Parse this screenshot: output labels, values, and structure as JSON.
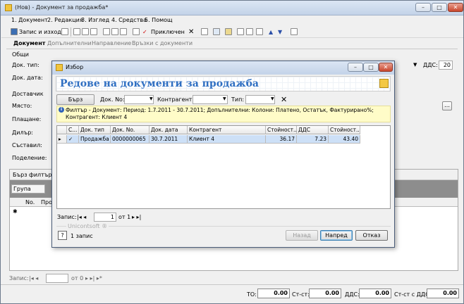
{
  "window": {
    "title": "(Нов) - Документ за продажба*"
  },
  "menu": [
    "1. Документ",
    "2. Редакция",
    "3. Изглед",
    "4. Средства",
    "5. Помощ"
  ],
  "toolbar": {
    "save_exit": "Запис и изход",
    "close_label": "Приключен"
  },
  "tabs": [
    "Документ",
    "Допълнителни",
    "Направление",
    "Връзки с документи"
  ],
  "form": {
    "section_general": "Общи",
    "doc_type_label": "Док. тип:",
    "doc_date_label": "Док. дата:",
    "vat_label": "ДДС:",
    "vat_value": "20",
    "section_supplier": "Доставчик",
    "place_label": "Място:",
    "payment_label": "Плащане:",
    "dealer_label": "Дилър:",
    "composer_label": "Съставил:",
    "division_label": "Поделение:"
  },
  "lower_grid": {
    "quick_filter": "Бърз филтър",
    "group": "Група",
    "col_no": "No.",
    "col_prod": "Прод"
  },
  "nav": {
    "record_label": "Запис:",
    "of_label": "от 0"
  },
  "totals": {
    "to_label": "ТО:",
    "to_value": "0.00",
    "cost_label": "Ст-ст:",
    "cost_value": "0.00",
    "vat_label": "ДДС:",
    "vat_value": "0.00",
    "cost_vat_label": "Ст-ст с ДДС:",
    "cost_vat_value": "0.00"
  },
  "dialog": {
    "title": "Избор",
    "heading": "Редове на документи за продажба",
    "quick_filter": "Бърз филтър",
    "doc_no_label": "Док. No:",
    "contragent_label": "Контрагент:",
    "type_label": "Тип:",
    "filter_text": "Филтър - Документ: Период: 1.7.2011 - 30.7.2011; Допълнителни: Колони: Платено, Остатък, Фактурирано%; Контрагент: Клиент 4",
    "columns": [
      "С...",
      "Док. тип",
      "Док. No.",
      "Док. дата",
      "Контрагент",
      "Стойност...",
      "ДДС",
      "Стойност..."
    ],
    "row": [
      "✓",
      "Продажба",
      "0000000065",
      "30.7.2011",
      "Клиент 4",
      "36.17",
      "7.23",
      "43.40"
    ],
    "nav_record_label": "Запис:",
    "nav_page": "1",
    "nav_of": "от 1",
    "brand": "Unicontsoft ®",
    "record_count": "1 запис",
    "back_button": "Назад",
    "next_button": "Напред",
    "cancel_button": "Отказ"
  }
}
